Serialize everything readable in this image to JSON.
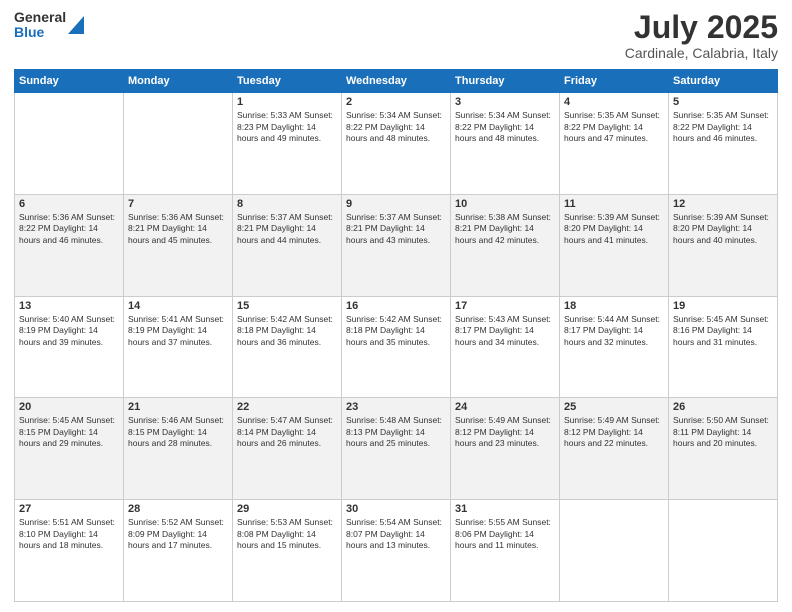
{
  "logo": {
    "general": "General",
    "blue": "Blue"
  },
  "title": {
    "month": "July 2025",
    "location": "Cardinale, Calabria, Italy"
  },
  "weekdays": [
    "Sunday",
    "Monday",
    "Tuesday",
    "Wednesday",
    "Thursday",
    "Friday",
    "Saturday"
  ],
  "weeks": [
    [
      {
        "day": "",
        "info": ""
      },
      {
        "day": "",
        "info": ""
      },
      {
        "day": "1",
        "info": "Sunrise: 5:33 AM\nSunset: 8:23 PM\nDaylight: 14 hours\nand 49 minutes."
      },
      {
        "day": "2",
        "info": "Sunrise: 5:34 AM\nSunset: 8:22 PM\nDaylight: 14 hours\nand 48 minutes."
      },
      {
        "day": "3",
        "info": "Sunrise: 5:34 AM\nSunset: 8:22 PM\nDaylight: 14 hours\nand 48 minutes."
      },
      {
        "day": "4",
        "info": "Sunrise: 5:35 AM\nSunset: 8:22 PM\nDaylight: 14 hours\nand 47 minutes."
      },
      {
        "day": "5",
        "info": "Sunrise: 5:35 AM\nSunset: 8:22 PM\nDaylight: 14 hours\nand 46 minutes."
      }
    ],
    [
      {
        "day": "6",
        "info": "Sunrise: 5:36 AM\nSunset: 8:22 PM\nDaylight: 14 hours\nand 46 minutes."
      },
      {
        "day": "7",
        "info": "Sunrise: 5:36 AM\nSunset: 8:21 PM\nDaylight: 14 hours\nand 45 minutes."
      },
      {
        "day": "8",
        "info": "Sunrise: 5:37 AM\nSunset: 8:21 PM\nDaylight: 14 hours\nand 44 minutes."
      },
      {
        "day": "9",
        "info": "Sunrise: 5:37 AM\nSunset: 8:21 PM\nDaylight: 14 hours\nand 43 minutes."
      },
      {
        "day": "10",
        "info": "Sunrise: 5:38 AM\nSunset: 8:21 PM\nDaylight: 14 hours\nand 42 minutes."
      },
      {
        "day": "11",
        "info": "Sunrise: 5:39 AM\nSunset: 8:20 PM\nDaylight: 14 hours\nand 41 minutes."
      },
      {
        "day": "12",
        "info": "Sunrise: 5:39 AM\nSunset: 8:20 PM\nDaylight: 14 hours\nand 40 minutes."
      }
    ],
    [
      {
        "day": "13",
        "info": "Sunrise: 5:40 AM\nSunset: 8:19 PM\nDaylight: 14 hours\nand 39 minutes."
      },
      {
        "day": "14",
        "info": "Sunrise: 5:41 AM\nSunset: 8:19 PM\nDaylight: 14 hours\nand 37 minutes."
      },
      {
        "day": "15",
        "info": "Sunrise: 5:42 AM\nSunset: 8:18 PM\nDaylight: 14 hours\nand 36 minutes."
      },
      {
        "day": "16",
        "info": "Sunrise: 5:42 AM\nSunset: 8:18 PM\nDaylight: 14 hours\nand 35 minutes."
      },
      {
        "day": "17",
        "info": "Sunrise: 5:43 AM\nSunset: 8:17 PM\nDaylight: 14 hours\nand 34 minutes."
      },
      {
        "day": "18",
        "info": "Sunrise: 5:44 AM\nSunset: 8:17 PM\nDaylight: 14 hours\nand 32 minutes."
      },
      {
        "day": "19",
        "info": "Sunrise: 5:45 AM\nSunset: 8:16 PM\nDaylight: 14 hours\nand 31 minutes."
      }
    ],
    [
      {
        "day": "20",
        "info": "Sunrise: 5:45 AM\nSunset: 8:15 PM\nDaylight: 14 hours\nand 29 minutes."
      },
      {
        "day": "21",
        "info": "Sunrise: 5:46 AM\nSunset: 8:15 PM\nDaylight: 14 hours\nand 28 minutes."
      },
      {
        "day": "22",
        "info": "Sunrise: 5:47 AM\nSunset: 8:14 PM\nDaylight: 14 hours\nand 26 minutes."
      },
      {
        "day": "23",
        "info": "Sunrise: 5:48 AM\nSunset: 8:13 PM\nDaylight: 14 hours\nand 25 minutes."
      },
      {
        "day": "24",
        "info": "Sunrise: 5:49 AM\nSunset: 8:12 PM\nDaylight: 14 hours\nand 23 minutes."
      },
      {
        "day": "25",
        "info": "Sunrise: 5:49 AM\nSunset: 8:12 PM\nDaylight: 14 hours\nand 22 minutes."
      },
      {
        "day": "26",
        "info": "Sunrise: 5:50 AM\nSunset: 8:11 PM\nDaylight: 14 hours\nand 20 minutes."
      }
    ],
    [
      {
        "day": "27",
        "info": "Sunrise: 5:51 AM\nSunset: 8:10 PM\nDaylight: 14 hours\nand 18 minutes."
      },
      {
        "day": "28",
        "info": "Sunrise: 5:52 AM\nSunset: 8:09 PM\nDaylight: 14 hours\nand 17 minutes."
      },
      {
        "day": "29",
        "info": "Sunrise: 5:53 AM\nSunset: 8:08 PM\nDaylight: 14 hours\nand 15 minutes."
      },
      {
        "day": "30",
        "info": "Sunrise: 5:54 AM\nSunset: 8:07 PM\nDaylight: 14 hours\nand 13 minutes."
      },
      {
        "day": "31",
        "info": "Sunrise: 5:55 AM\nSunset: 8:06 PM\nDaylight: 14 hours\nand 11 minutes."
      },
      {
        "day": "",
        "info": ""
      },
      {
        "day": "",
        "info": ""
      }
    ]
  ]
}
